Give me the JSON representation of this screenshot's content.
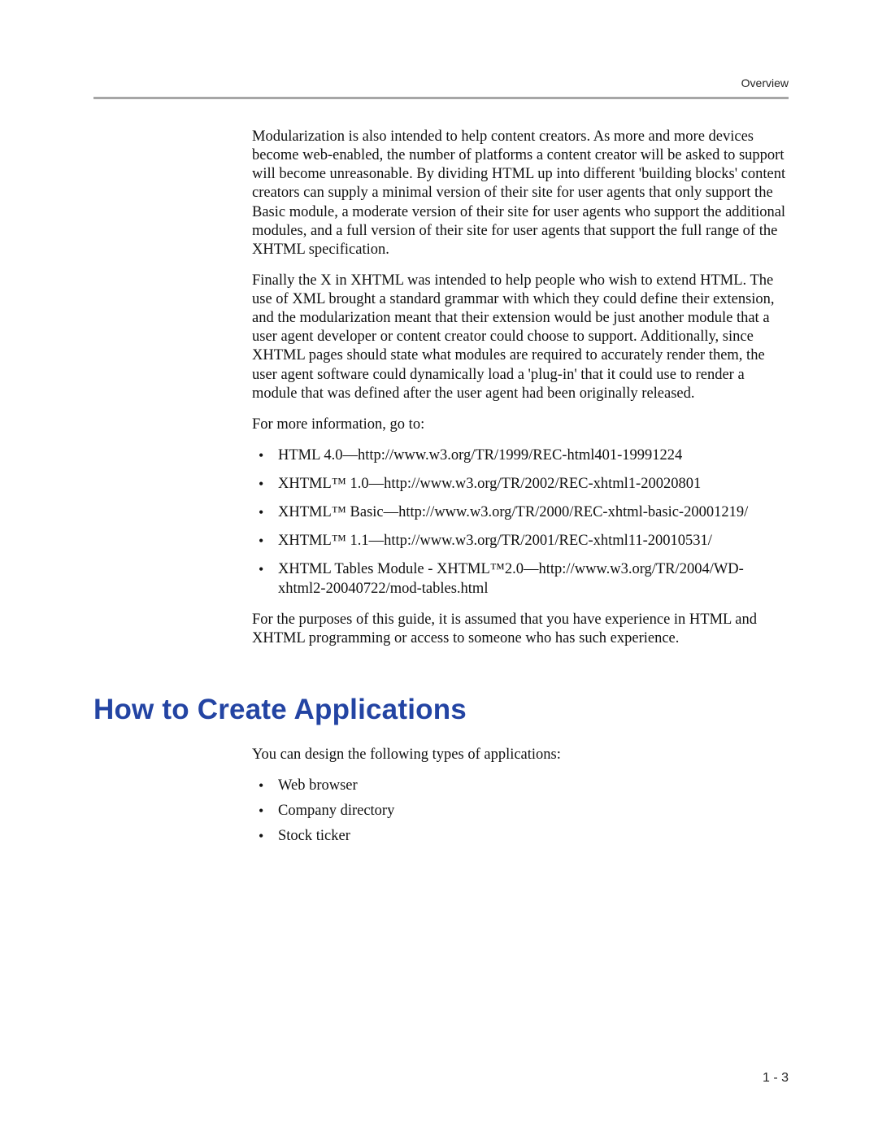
{
  "header": {
    "label": "Overview"
  },
  "paragraphs": {
    "p1": "Modularization is also intended to help content creators. As more and more devices become web-enabled, the number of platforms a content creator will be asked to support will become unreasonable. By dividing HTML up into different 'building blocks' content creators can supply a minimal version of their site for user agents that only support the Basic module, a moderate version of their site for user agents who support the additional modules, and a full version of their site for user agents that support the full range of the XHTML specification.",
    "p2": "Finally the X in XHTML was intended to help people who wish to extend HTML. The use of XML brought a standard grammar with which they could define their extension, and the modularization meant that their extension would be just another module that a user agent developer or content creator could choose to support. Additionally, since XHTML pages should state what modules are required to accurately render them, the user agent software could dynamically load a 'plug-in' that it could use to render a module that was defined after the user agent had been originally released.",
    "p3": "For more information, go to:",
    "p4": "For the purposes of this guide, it is assumed that you have experience in HTML and XHTML programming or access to someone who has such experience.",
    "p5": "You can design the following types of applications:"
  },
  "refs": [
    "HTML 4.0—http://www.w3.org/TR/1999/REC-html401-19991224",
    "XHTML™ 1.0—http://www.w3.org/TR/2002/REC-xhtml1-20020801",
    "XHTML™ Basic—http://www.w3.org/TR/2000/REC-xhtml-basic-20001219/",
    "XHTML™ 1.1—http://www.w3.org/TR/2001/REC-xhtml11-20010531/",
    "XHTML Tables Module - XHTML™2.0—http://www.w3.org/TR/2004/WD-xhtml2-20040722/mod-tables.html"
  ],
  "section_heading": "How to Create Applications",
  "apps": [
    "Web browser",
    "Company directory",
    "Stock ticker"
  ],
  "page_number": "1 - 3"
}
